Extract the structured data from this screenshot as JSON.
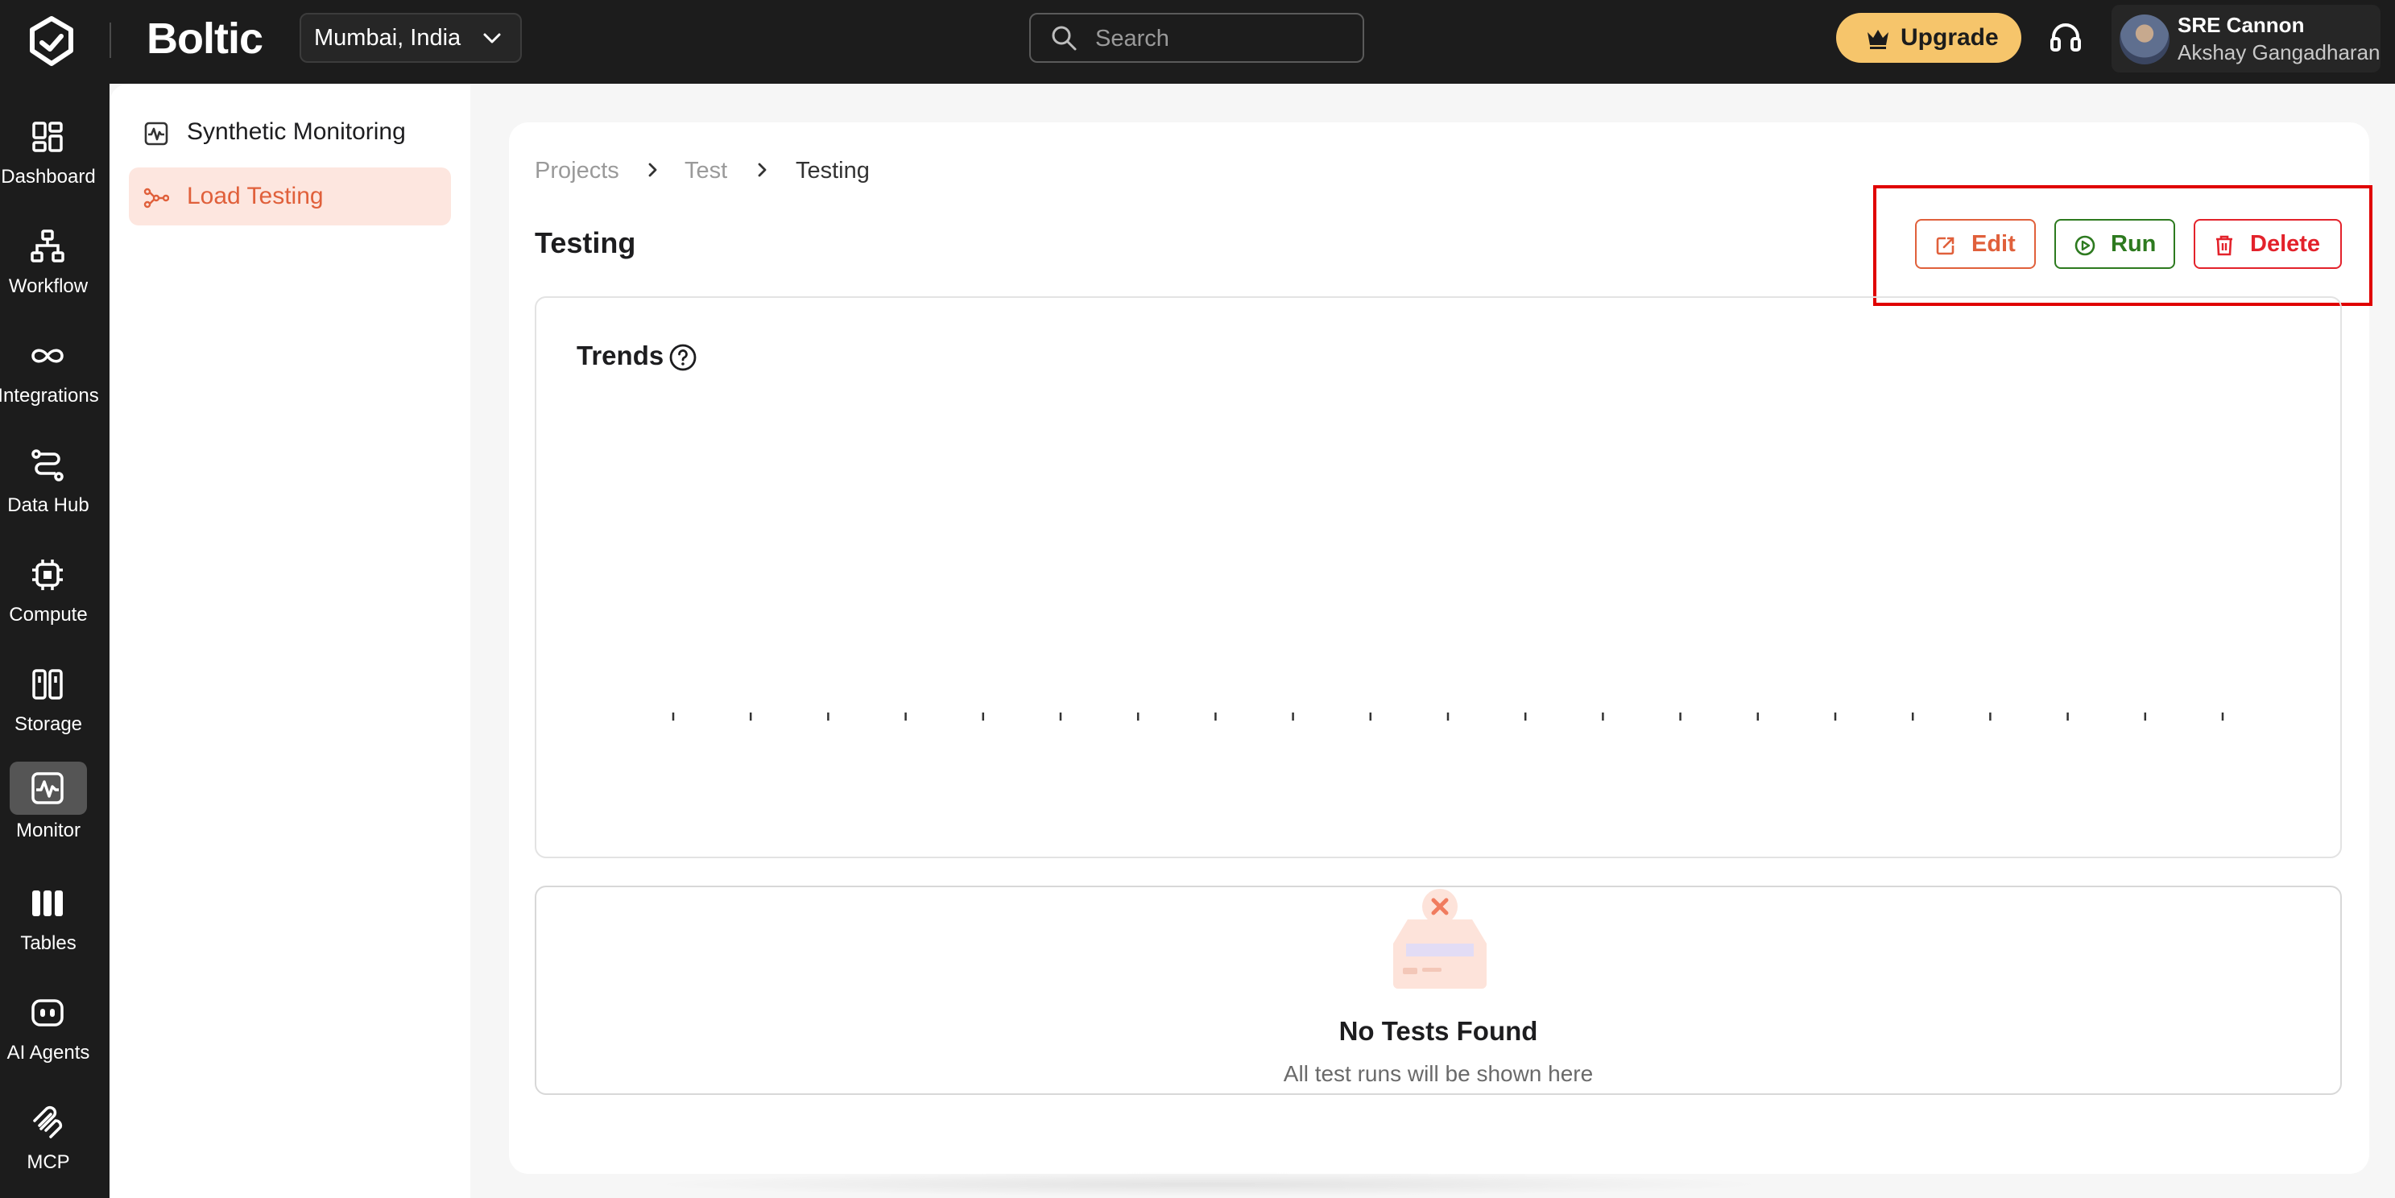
{
  "app": {
    "brand": "Boltic",
    "region": "Mumbai, India",
    "search_placeholder": "Search",
    "upgrade_label": "Upgrade",
    "user": {
      "name": "SRE Cannon",
      "sub": "Akshay Gangadharan"
    }
  },
  "rail": {
    "items": [
      {
        "label": "Dashboard",
        "icon": "dashboard-icon",
        "active": false
      },
      {
        "label": "Workflow",
        "icon": "workflow-icon",
        "active": false
      },
      {
        "label": "Integrations",
        "icon": "integrations-icon",
        "active": false
      },
      {
        "label": "Data Hub",
        "icon": "data-hub-icon",
        "active": false
      },
      {
        "label": "Compute",
        "icon": "compute-icon",
        "active": false
      },
      {
        "label": "Storage",
        "icon": "storage-icon",
        "active": false
      },
      {
        "label": "Monitor",
        "icon": "monitor-icon",
        "active": true
      },
      {
        "label": "Tables",
        "icon": "tables-icon",
        "active": false
      },
      {
        "label": "AI Agents",
        "icon": "ai-agents-icon",
        "active": false
      },
      {
        "label": "MCP",
        "icon": "mcp-icon",
        "active": false
      }
    ]
  },
  "subnav": {
    "items": [
      {
        "label": "Synthetic Monitoring",
        "icon": "synthetic-monitoring-icon",
        "active": false
      },
      {
        "label": "Load Testing",
        "icon": "load-testing-icon",
        "active": true
      }
    ]
  },
  "breadcrumb": [
    "Projects",
    "Test",
    "Testing"
  ],
  "page": {
    "title": "Testing",
    "actions": {
      "edit": "Edit",
      "run": "Run",
      "delete": "Delete"
    }
  },
  "trends": {
    "title": "Trends"
  },
  "chart_data": {
    "type": "line",
    "x": [],
    "series": [],
    "x_tick_count": 21,
    "grid": false
  },
  "tests": {
    "empty_title": "No Tests Found",
    "empty_subtitle": "All test runs will be shown here"
  },
  "colors": {
    "accent": "#e0603b",
    "run": "#2d7a1f",
    "delete": "#e3222b",
    "upgrade": "#f6c56b",
    "highlight": "#e00000"
  }
}
